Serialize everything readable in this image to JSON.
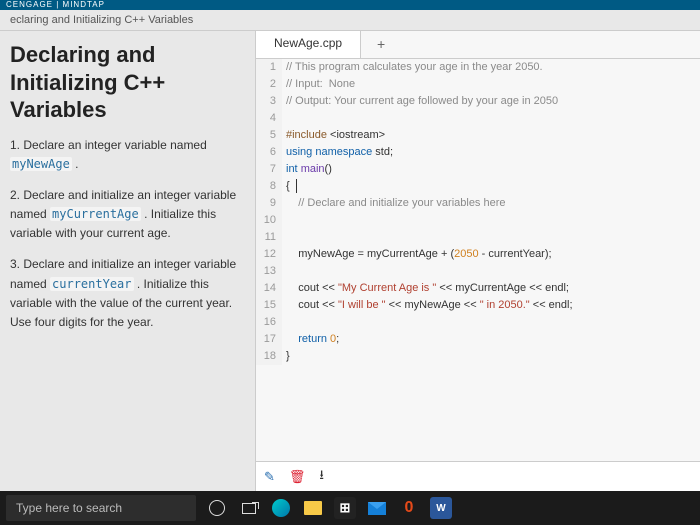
{
  "brand": "CENGAGE | MINDTAP",
  "breadcrumb": "eclaring and Initializing C++ Variables",
  "left": {
    "title": "Declaring and Initializing C++ Variables",
    "steps": [
      {
        "num": "1.",
        "pre": "Declare an integer variable named ",
        "code": "myNewAge",
        "post": " ."
      },
      {
        "num": "2.",
        "pre": "Declare and initialize an integer variable named ",
        "code": "myCurrentAge",
        "post": " . Initialize this variable with your current age."
      },
      {
        "num": "3.",
        "pre": "Declare and initialize an integer variable named ",
        "code": "currentYear",
        "post": " . Initialize this variable with the value of the current year. Use four digits for the year."
      }
    ]
  },
  "tabs": {
    "file": "NewAge.cpp",
    "add": "+"
  },
  "code": {
    "lines": [
      {
        "n": "1",
        "segs": [
          {
            "c": "cm-comment",
            "t": "// This program calculates your age in the year 2050."
          }
        ]
      },
      {
        "n": "2",
        "segs": [
          {
            "c": "cm-comment",
            "t": "// Input:  None"
          }
        ]
      },
      {
        "n": "3",
        "segs": [
          {
            "c": "cm-comment",
            "t": "// Output: Your current age followed by your age in 2050"
          }
        ]
      },
      {
        "n": "4",
        "segs": []
      },
      {
        "n": "5",
        "segs": [
          {
            "c": "cm-pre",
            "t": "#include "
          },
          {
            "c": "",
            "t": "<iostream>"
          }
        ]
      },
      {
        "n": "6",
        "segs": [
          {
            "c": "cm-kw",
            "t": "using namespace "
          },
          {
            "c": "",
            "t": "std;"
          }
        ]
      },
      {
        "n": "7",
        "segs": [
          {
            "c": "cm-type",
            "t": "int "
          },
          {
            "c": "cm-fn",
            "t": "main"
          },
          {
            "c": "",
            "t": "()"
          }
        ]
      },
      {
        "n": "8",
        "segs": [
          {
            "c": "",
            "t": "{"
          }
        ],
        "cursor": true
      },
      {
        "n": "9",
        "segs": [
          {
            "c": "",
            "t": "    "
          },
          {
            "c": "cm-comment",
            "t": "// Declare and initialize your variables here"
          }
        ]
      },
      {
        "n": "10",
        "segs": []
      },
      {
        "n": "11",
        "segs": []
      },
      {
        "n": "12",
        "segs": [
          {
            "c": "",
            "t": "    myNewAge = myCurrentAge + ("
          },
          {
            "c": "cm-num",
            "t": "2050"
          },
          {
            "c": "",
            "t": " - currentYear);"
          }
        ]
      },
      {
        "n": "13",
        "segs": []
      },
      {
        "n": "14",
        "segs": [
          {
            "c": "",
            "t": "    cout << "
          },
          {
            "c": "cm-str",
            "t": "\"My Current Age is \""
          },
          {
            "c": "",
            "t": " << myCurrentAge << endl;"
          }
        ]
      },
      {
        "n": "15",
        "segs": [
          {
            "c": "",
            "t": "    cout << "
          },
          {
            "c": "cm-str",
            "t": "\"I will be \""
          },
          {
            "c": "",
            "t": " << myNewAge << "
          },
          {
            "c": "cm-str",
            "t": "\" in 2050.\""
          },
          {
            "c": "",
            "t": " << endl;"
          }
        ]
      },
      {
        "n": "16",
        "segs": []
      },
      {
        "n": "17",
        "segs": [
          {
            "c": "",
            "t": "    "
          },
          {
            "c": "cm-kw",
            "t": "return "
          },
          {
            "c": "cm-num",
            "t": "0"
          },
          {
            "c": "",
            "t": ";"
          }
        ]
      },
      {
        "n": "18",
        "segs": [
          {
            "c": "",
            "t": "}"
          }
        ]
      }
    ]
  },
  "tools": {
    "pencil": "✎",
    "trash": "🗑",
    "download": "⭳"
  },
  "taskbar": {
    "search_placeholder": "Type here to search",
    "store_label": "⊞",
    "office_label": "0",
    "word_label": "W"
  }
}
